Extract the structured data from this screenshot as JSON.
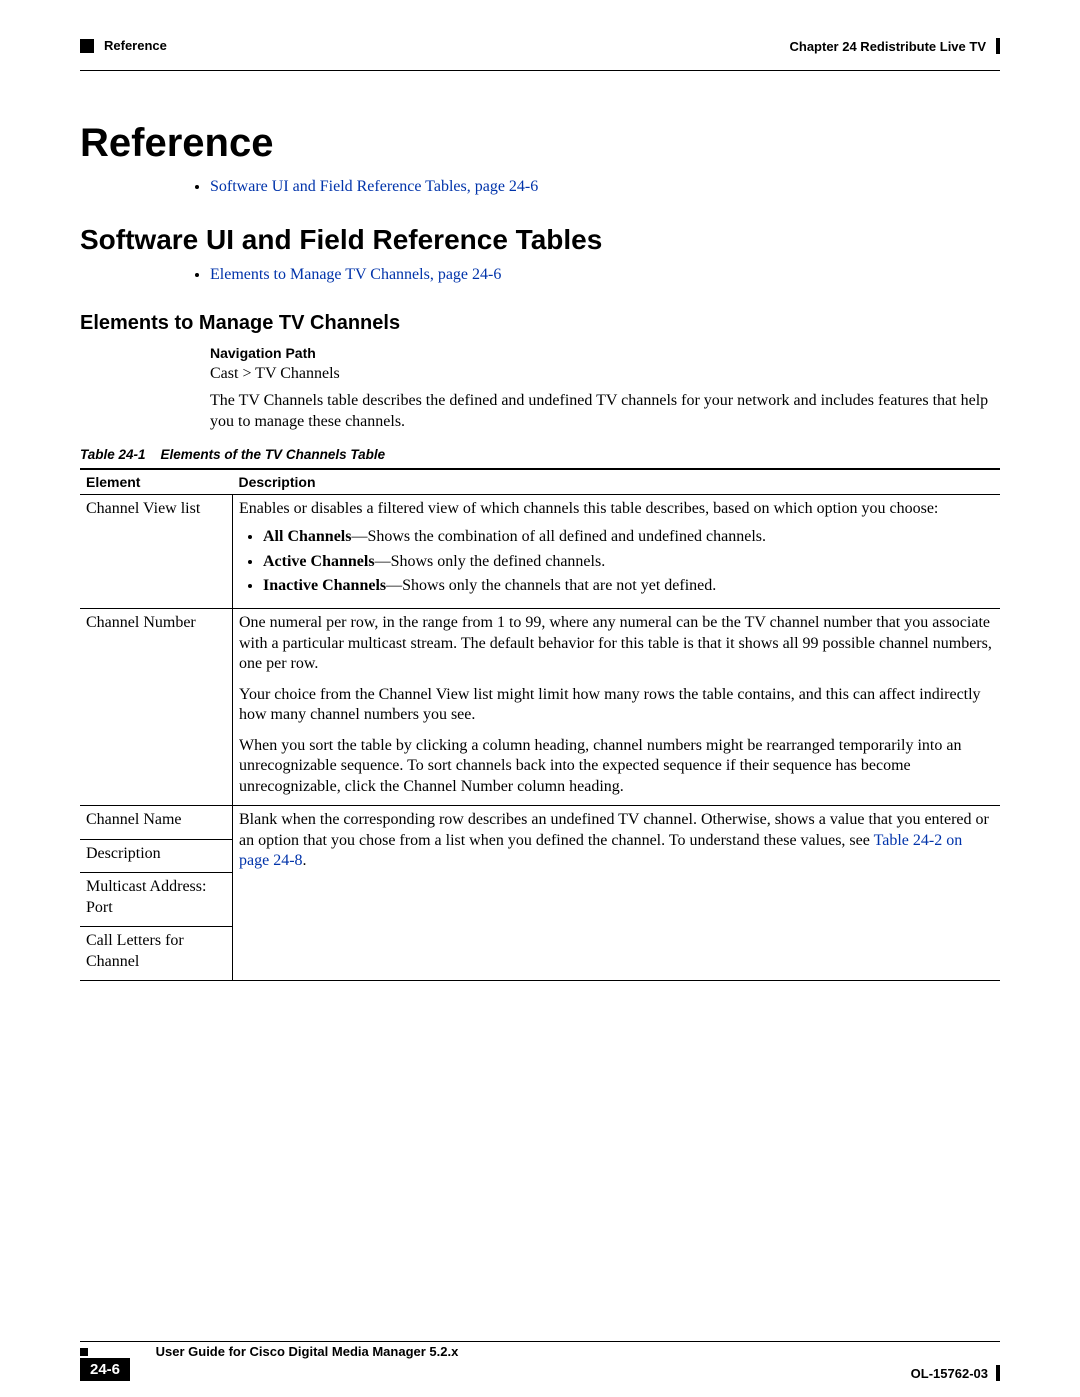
{
  "header": {
    "section": "Reference",
    "chapter": "Chapter 24    Redistribute Live TV"
  },
  "h1": "Reference",
  "link1": "Software UI and Field Reference Tables, page 24-6",
  "h2": "Software UI and Field Reference Tables",
  "link2": "Elements to Manage TV Channels, page 24-6",
  "h3": "Elements to Manage TV Channels",
  "nav": {
    "label": "Navigation Path",
    "value": "Cast > TV Channels"
  },
  "intro": "The TV Channels table describes the defined and undefined TV channels for your network and includes features that help you to manage these channels.",
  "table": {
    "caption_num": "Table 24-1",
    "caption_title": "Elements of the TV Channels Table",
    "col1": "Element",
    "col2": "Description",
    "rows": {
      "r1_elem": "Channel View list",
      "r1_p1": "Enables or disables a filtered view of which channels this table describes, based on which option you choose:",
      "r1_li1_b": "All Channels",
      "r1_li1_t": "—Shows the combination of all defined and undefined channels.",
      "r1_li2_b": "Active Channels",
      "r1_li2_t": "—Shows only the defined channels.",
      "r1_li3_b": "Inactive Channels",
      "r1_li3_t": "—Shows only the channels that are not yet defined.",
      "r2_elem": "Channel Number",
      "r2_p1": "One numeral per row, in the range from 1 to 99, where any numeral can be the TV channel number that you associate with a particular multicast stream. The default behavior for this table is that it shows all 99 possible channel numbers, one per row.",
      "r2_p2": "Your choice from the Channel View list might limit how many rows the table contains, and this can affect indirectly how many channel numbers you see.",
      "r2_p3": "When you sort the table by clicking a column heading, channel numbers might be rearranged temporarily into an unrecognizable sequence. To sort channels back into the expected sequence if their sequence has become unrecognizable, click the Channel Number column heading.",
      "r3_elem": "Channel Name",
      "r4_elem": "Description",
      "r5_elem": "Multicast Address: Port",
      "r6_elem": "Call Letters for Channel",
      "shared_p1a": "Blank when the corresponding row describes an undefined TV channel. Otherwise, shows a value that you entered or an option that you chose from a list when you defined the channel. To understand these values, see ",
      "shared_link": "Table 24-2 on page 24-8",
      "shared_p1b": "."
    }
  },
  "footer": {
    "title": "User Guide for Cisco Digital Media Manager 5.2.x",
    "page": "24-6",
    "docid": "OL-15762-03"
  }
}
